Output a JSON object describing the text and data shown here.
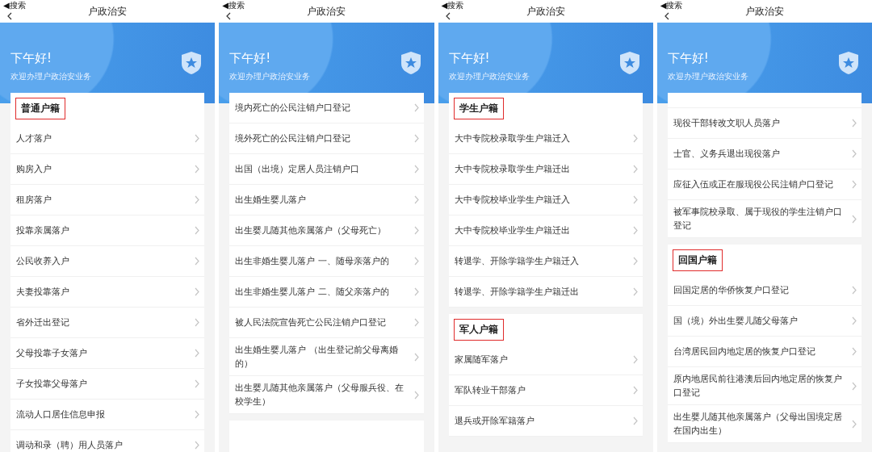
{
  "screens": [
    {
      "nav": {
        "back": "◀搜索",
        "title": "户政治安"
      },
      "header": {
        "greeting": "下午好!",
        "subtitle": "欢迎办理户政治安业务"
      },
      "sections": [
        {
          "title": {
            "text": "普通户籍",
            "highlighted": true
          },
          "items": [
            {
              "label": "人才落户"
            },
            {
              "label": "购房入户"
            },
            {
              "label": "租房落户"
            },
            {
              "label": "投靠亲属落户"
            },
            {
              "label": "公民收养入户"
            },
            {
              "label": "夫妻投靠落户"
            },
            {
              "label": "省外迁出登记"
            },
            {
              "label": "父母投靠子女落户"
            },
            {
              "label": "子女投靠父母落户"
            },
            {
              "label": "流动人口居住信息申报"
            },
            {
              "label": "调动和录（聘）用人员落户"
            }
          ]
        }
      ]
    },
    {
      "nav": {
        "back": "◀搜索",
        "title": "户政治安"
      },
      "header": {
        "greeting": "下午好!",
        "subtitle": "欢迎办理户政治安业务"
      },
      "more_below": true,
      "sections": [
        {
          "items": [
            {
              "label": "境内死亡的公民注销户口登记"
            },
            {
              "label": "境外死亡的公民注销户口登记"
            },
            {
              "label": "出国（出境）定居人员注销户口"
            },
            {
              "label": "出生婚生婴儿落户"
            },
            {
              "label": "出生婴儿随其他亲属落户（父母死亡）"
            },
            {
              "label": "出生非婚生婴儿落户 一、随母亲落户的"
            },
            {
              "label": "出生非婚生婴儿落户 二、随父亲落户的"
            },
            {
              "label": "被人民法院宣告死亡公民注销户口登记"
            },
            {
              "label": "出生婚生婴儿落户 （出生登记前父母离婚的）"
            },
            {
              "label": "出生婴儿随其他亲属落户（父母服兵役、在校学生）"
            }
          ]
        }
      ]
    },
    {
      "nav": {
        "back": "◀搜索",
        "title": "户政治安"
      },
      "header": {
        "greeting": "下午好!",
        "subtitle": "欢迎办理户政治安业务"
      },
      "sections": [
        {
          "title": {
            "text": "学生户籍",
            "highlighted": true
          },
          "items": [
            {
              "label": "大中专院校录取学生户籍迁入"
            },
            {
              "label": "大中专院校录取学生户籍迁出"
            },
            {
              "label": "大中专院校毕业学生户籍迁入"
            },
            {
              "label": "大中专院校毕业学生户籍迁出"
            },
            {
              "label": "转退学、开除学籍学生户籍迁入"
            },
            {
              "label": "转退学、开除学籍学生户籍迁出"
            }
          ]
        },
        {
          "title": {
            "text": "军人户籍",
            "highlighted": true
          },
          "items": [
            {
              "label": "家属随军落户"
            },
            {
              "label": "军队转业干部落户"
            },
            {
              "label": "退兵或开除军籍落户"
            }
          ]
        }
      ]
    },
    {
      "nav": {
        "back": "◀搜索",
        "title": "户政治安"
      },
      "header": {
        "greeting": "下午好!",
        "subtitle": "欢迎办理户政治安业务"
      },
      "sections": [
        {
          "continued": true,
          "items": [
            {
              "label": "现役干部转改文职人员落户"
            },
            {
              "label": "士官、义务兵退出现役落户"
            },
            {
              "label": "应征入伍或正在服现役公民注销户口登记"
            },
            {
              "label": "被军事院校录取、属于现役的学生注销户口登记"
            }
          ]
        },
        {
          "title": {
            "text": "回国户籍",
            "highlighted": true
          },
          "items": [
            {
              "label": "回国定居的华侨恢复户口登记"
            },
            {
              "label": "国（境）外出生婴儿随父母落户"
            },
            {
              "label": "台湾居民回内地定居的恢复户口登记"
            },
            {
              "label": "原内地居民前往港澳后回内地定居的恢复户口登记"
            },
            {
              "label": "出生婴儿随其他亲属落户（父母出国境定居在国内出生）"
            }
          ]
        }
      ]
    }
  ]
}
